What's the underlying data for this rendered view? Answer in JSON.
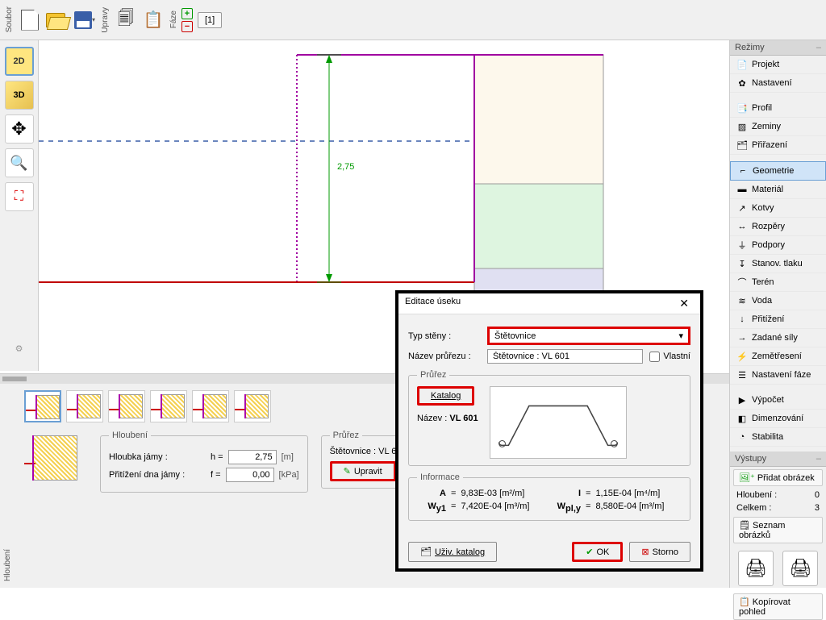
{
  "toolbar": {
    "group_file": "Soubor",
    "group_edit": "Úpravy",
    "group_phase": "Fáze",
    "phase_tab": "[1]"
  },
  "left": {
    "2d": "2D",
    "3d": "3D"
  },
  "canvas": {
    "dim": "2,75"
  },
  "modes": {
    "header": "Režimy",
    "items": [
      {
        "label": "Projekt",
        "icon": "📄"
      },
      {
        "label": "Nastavení",
        "icon": "✿"
      },
      {
        "label": "Profil",
        "icon": "📑"
      },
      {
        "label": "Zeminy",
        "icon": "▨"
      },
      {
        "label": "Přiřazení",
        "icon": "🗂"
      },
      {
        "label": "Geometrie",
        "icon": "⌐"
      },
      {
        "label": "Materiál",
        "icon": "▬"
      },
      {
        "label": "Kotvy",
        "icon": "↗"
      },
      {
        "label": "Rozpěry",
        "icon": "↔"
      },
      {
        "label": "Podpory",
        "icon": "⏚"
      },
      {
        "label": "Stanov. tlaku",
        "icon": "↧"
      },
      {
        "label": "Terén",
        "icon": "⌒"
      },
      {
        "label": "Voda",
        "icon": "≋"
      },
      {
        "label": "Přitížení",
        "icon": "↓"
      },
      {
        "label": "Zadané síly",
        "icon": "→"
      },
      {
        "label": "Zemětřesení",
        "icon": "⚡"
      },
      {
        "label": "Nastavení fáze",
        "icon": "☰"
      },
      {
        "label": "Výpočet",
        "icon": "▶"
      },
      {
        "label": "Dimenzování",
        "icon": "◧"
      },
      {
        "label": "Stabilita",
        "icon": "◔"
      }
    ]
  },
  "outputs": {
    "header": "Výstupy",
    "add_image": "Přidat obrázek",
    "rows": [
      {
        "label": "Hloubení :",
        "val": "0"
      },
      {
        "label": "Celkem :",
        "val": "3"
      }
    ],
    "list": "Seznam obrázků",
    "copy": "Kopírovat pohled"
  },
  "bottom": {
    "vlabel": "Hloubení",
    "excavation": {
      "legend": "Hloubení",
      "depth_label": "Hloubka jámy :",
      "depth_sym": "h =",
      "depth_val": "2,75",
      "depth_unit": "[m]",
      "load_label": "Přitížení dna jámy :",
      "load_sym": "f =",
      "load_val": "0,00",
      "load_unit": "[kPa]"
    },
    "section": {
      "legend": "Průřez",
      "name": "Štětovnice : VL 601",
      "edit": "Upravit"
    }
  },
  "dialog": {
    "title": "Editace úseku",
    "wall_type_label": "Typ stěny :",
    "wall_type": "Štětovnice",
    "name_label": "Název průřezu :",
    "name_val": "Štětovnice : VL 601",
    "custom": "Vlastní",
    "fs_section": "Průřez",
    "catalog": "Katalog",
    "name2_label": "Název :",
    "name2_val": "VL 601",
    "fs_info": "Informace",
    "info": {
      "A": "A",
      "A_v": "9,83E-03 [m²/m]",
      "I": "I",
      "I_v": "1,15E-04 [m⁴/m]",
      "W": "W<sub>y1</sub>",
      "W_v": "7,420E-04 [m³/m]",
      "Wpl": "W<sub>pl,y</sub>",
      "Wpl_v": "8,580E-04 [m³/m]"
    },
    "user_cat": "Uživ. katalog",
    "ok": "OK",
    "cancel": "Storno"
  }
}
